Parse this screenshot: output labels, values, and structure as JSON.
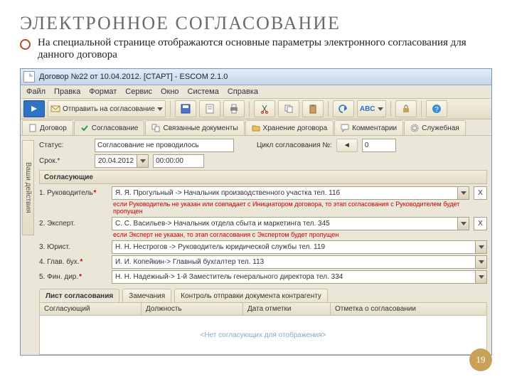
{
  "slide": {
    "title": "ЭЛЕКТРОННОЕ СОГЛАСОВАНИЕ",
    "subtitle": "На специальной странице отображаются основные параметры электронного согласования для данного договора",
    "page_number": "19"
  },
  "window": {
    "title": "Договор №22 от 10.04.2012. [СТАРТ] - ESCOM 2.1.0"
  },
  "menu": [
    "Файл",
    "Правка",
    "Формат",
    "Сервис",
    "Окно",
    "Система",
    "Справка"
  ],
  "toolbar": {
    "send_label": "Отправить на согласование"
  },
  "side_label": "Ваши действия",
  "tabs": [
    {
      "icon": "doc",
      "label": "Договор"
    },
    {
      "icon": "check",
      "label": "Согласование"
    },
    {
      "icon": "link",
      "label": "Связанные документы"
    },
    {
      "icon": "folder",
      "label": "Хранение договора"
    },
    {
      "icon": "comment",
      "label": "Комментарии"
    },
    {
      "icon": "gear",
      "label": "Служебная"
    }
  ],
  "fields": {
    "status_label": "Статус:",
    "status_value": "Согласование не проводилось",
    "cycle_label": "Цикл согласования №:",
    "cycle_value": "0",
    "deadline_label": "Срок.*",
    "deadline_date": "20.04.2012",
    "deadline_time": "00:00:00"
  },
  "approvers_header": "Согласующие",
  "approver_labels": [
    "1. Руководитель",
    "2. Эксперт.",
    "3. Юрист.",
    "4. Глав. бух.",
    "5. Фин. дир."
  ],
  "approver_values": [
    "Я. Я. Прогульный -> Начальник производственного участка тел. 116",
    "С. С. Васильев-> Начальник отдела сбыта и маркетинга тел. 345",
    "Н. Н. Нестрогов -> Руководитель юридической службы тел. 119",
    "И. И. Копейкин-> Главный бухгалтер тел. 113",
    "Н. Н. Надежный-> 1-й Заместитель генерального директора тел. 334"
  ],
  "approver_required": [
    true,
    false,
    false,
    true,
    true
  ],
  "hints": {
    "after_1": "если Руководитель не указан или совпадает с Инициатором договора, то этап согласования с Руководителем будет пропущен",
    "after_2": "если Эксперт не указан, то этап согласования с Экспертом будет пропущен"
  },
  "subtabs": [
    "Лист согласования",
    "Замечания",
    "Контроль отправки документа контрагенту"
  ],
  "table_headers": [
    "Согласующий",
    "Должность",
    "Дата отметки",
    "Отметка о согласовании"
  ],
  "empty_message": "<Нет согласующих для отображения>"
}
